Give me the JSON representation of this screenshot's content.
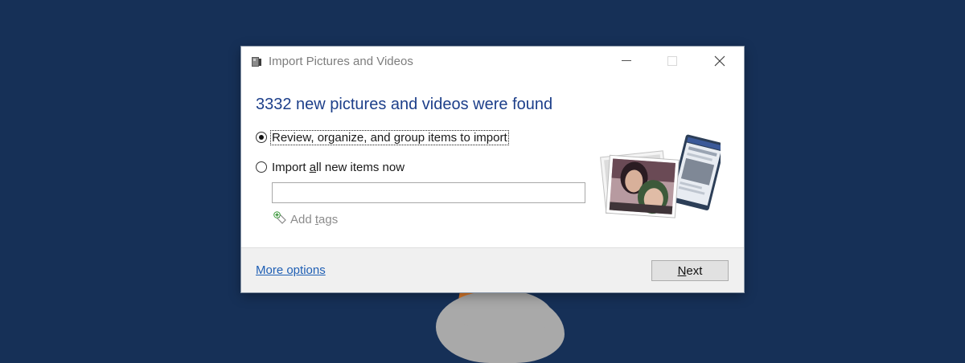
{
  "window": {
    "title": "Import Pictures and Videos"
  },
  "heading": "3332 new pictures and videos were found",
  "options": {
    "review": {
      "label": "Review, organize, and group items to import",
      "selected": true
    },
    "import_all": {
      "label_before": "Import ",
      "label_access": "a",
      "label_after": "ll new items now",
      "selected": false
    }
  },
  "tags": {
    "input_value": "",
    "add_label_before": "Add ",
    "add_label_access": "t",
    "add_label_after": "ags"
  },
  "footer": {
    "more_options": "More options",
    "next_access": "N",
    "next_rest": "ext"
  },
  "colors": {
    "desktop": "#163057",
    "heading": "#1d3f8a",
    "link": "#1f5fb4"
  },
  "icons": {
    "app": "camera-device-icon",
    "add_tag": "tag-plus-icon",
    "thumbnail": "photo-stack-icon"
  }
}
